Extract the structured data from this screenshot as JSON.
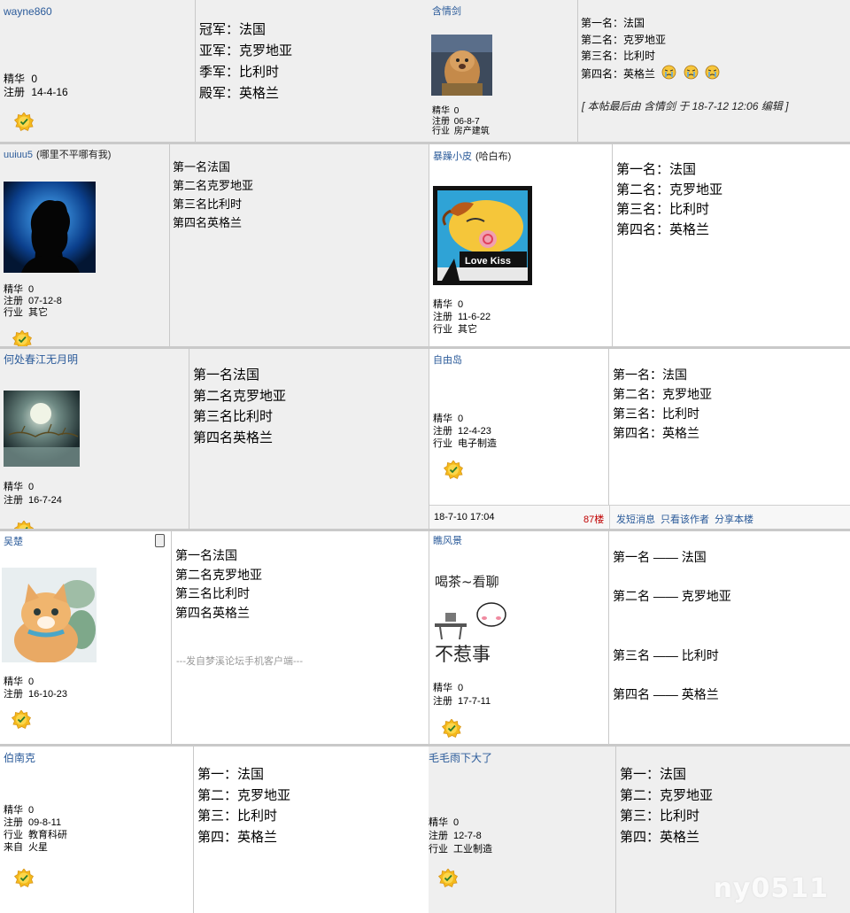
{
  "stats_labels": {
    "jinghua": "精华",
    "zhuce": "注册",
    "hangye": "行业",
    "laizi": "来自"
  },
  "posts": {
    "wayne": {
      "username": "wayne860",
      "jinghua": "0",
      "zhuce": "14-4-16",
      "lines": [
        "冠军：法国",
        "亚军：克罗地亚",
        "季军：比利时",
        "殿军：英格兰"
      ]
    },
    "hanqing": {
      "username": "含情剑",
      "jinghua": "0",
      "zhuce": "06-8-7",
      "hangye": "房产建筑",
      "lines": [
        "第一名：法国",
        "第二名：克罗地亚",
        "第三名：比利时",
        "第四名：英格兰"
      ],
      "edit_note": "[ 本帖最后由 含情剑 于 18-7-12 12:06 编辑 ]"
    },
    "uuiuu5": {
      "username": "uuiuu5",
      "title": "(哪里不平哪有我)",
      "jinghua": "0",
      "zhuce": "07-12-8",
      "hangye": "其它",
      "lines": [
        "第一名法国",
        "第二名克罗地亚",
        "第三名比利时",
        "第四名英格兰"
      ]
    },
    "baozao": {
      "username": "暴躁小皮",
      "title": "(哈白布)",
      "jinghua": "0",
      "zhuce": "11-6-22",
      "hangye": "其它",
      "avatar_text": "Love Kiss",
      "lines": [
        "第一名：法国",
        "第二名：克罗地亚",
        "第三名：比利时",
        "第四名：英格兰"
      ]
    },
    "hechu": {
      "username": "何处春江无月明",
      "jinghua": "0",
      "zhuce": "16-7-24",
      "lines": [
        "第一名法国",
        "第二名克罗地亚",
        "第三名比利时",
        "第四名英格兰"
      ]
    },
    "ziyou": {
      "username": "自由岛",
      "jinghua": "0",
      "zhuce": "12-4-23",
      "hangye": "电子制造",
      "lines": [
        "第一名：法国",
        "第二名：克罗地亚",
        "第三名：比利时",
        "第四名：英格兰"
      ],
      "footer": {
        "time": "18-7-10 17:04",
        "floor": "87楼",
        "actions": [
          "发短消息",
          "只看该作者",
          "分享本楼"
        ]
      }
    },
    "wuchu": {
      "username": "吴楚",
      "jinghua": "0",
      "zhuce": "16-10-23",
      "lines": [
        "第一名法国",
        "第二名克罗地亚",
        "第三名比利时",
        "第四名英格兰"
      ],
      "client_note": "---发自梦溪论坛手机客户端---"
    },
    "qiaofeng": {
      "username": "瞧风景",
      "jinghua": "0",
      "zhuce": "17-7-11",
      "avatar_text_top": "喝茶~看聊",
      "avatar_text_bottom": "不惹事",
      "lines": [
        "第一名 —— 法国",
        "第二名 —— 克罗地亚",
        "第三名 —— 比利时",
        "第四名 —— 英格兰"
      ]
    },
    "bonanke": {
      "username": "伯南克",
      "jinghua": "0",
      "zhuce": "09-8-11",
      "hangye": "教育科研",
      "laizi": "火星",
      "lines": [
        "第一：法国",
        "第二：克罗地亚",
        "第三：比利时",
        "第四：英格兰"
      ]
    },
    "maomao": {
      "username": "毛毛雨下大了",
      "jinghua": "0",
      "zhuce": "12-7-8",
      "hangye": "工业制造",
      "lines": [
        "第一：法国",
        "第二：克罗地亚",
        "第三：比利时",
        "第四：英格兰"
      ]
    }
  },
  "watermark": "ny0511"
}
